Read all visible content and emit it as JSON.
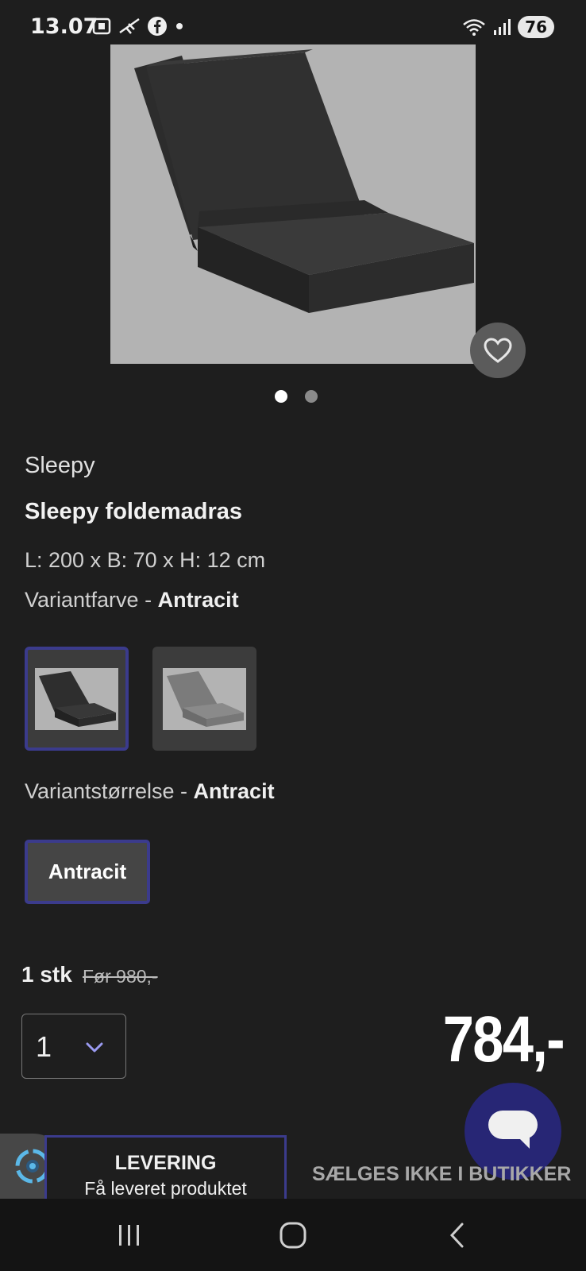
{
  "status_bar": {
    "time": "13.07",
    "battery": "76"
  },
  "product": {
    "brand": "Sleepy",
    "title": "Sleepy foldemadras",
    "dimensions": "L: 200 x B: 70 x H: 12 cm",
    "variant_color_label": "Variantfarve - ",
    "variant_color_value": "Antracit",
    "variant_size_label": "Variantstørrelse - ",
    "variant_size_value": "Antracit",
    "size_option": "Antracit",
    "image_count": 2,
    "active_image": 1
  },
  "swatches": [
    {
      "name": "dark",
      "selected": true,
      "color": "#2a2a2a"
    },
    {
      "name": "grey",
      "selected": false,
      "color": "#767676"
    }
  ],
  "pricing": {
    "unit": "1 stk",
    "old_price": "Før 980,-",
    "price": "784,-"
  },
  "quantity": {
    "value": "1"
  },
  "tabs": {
    "delivery_title": "LEVERING",
    "delivery_subtitle": "Få leveret produktet",
    "store": "SÆLGES IKKE I BUTIKKER"
  },
  "colors": {
    "accent": "#3b3b8c",
    "chat": "#272675",
    "background": "#1e1e1e"
  }
}
